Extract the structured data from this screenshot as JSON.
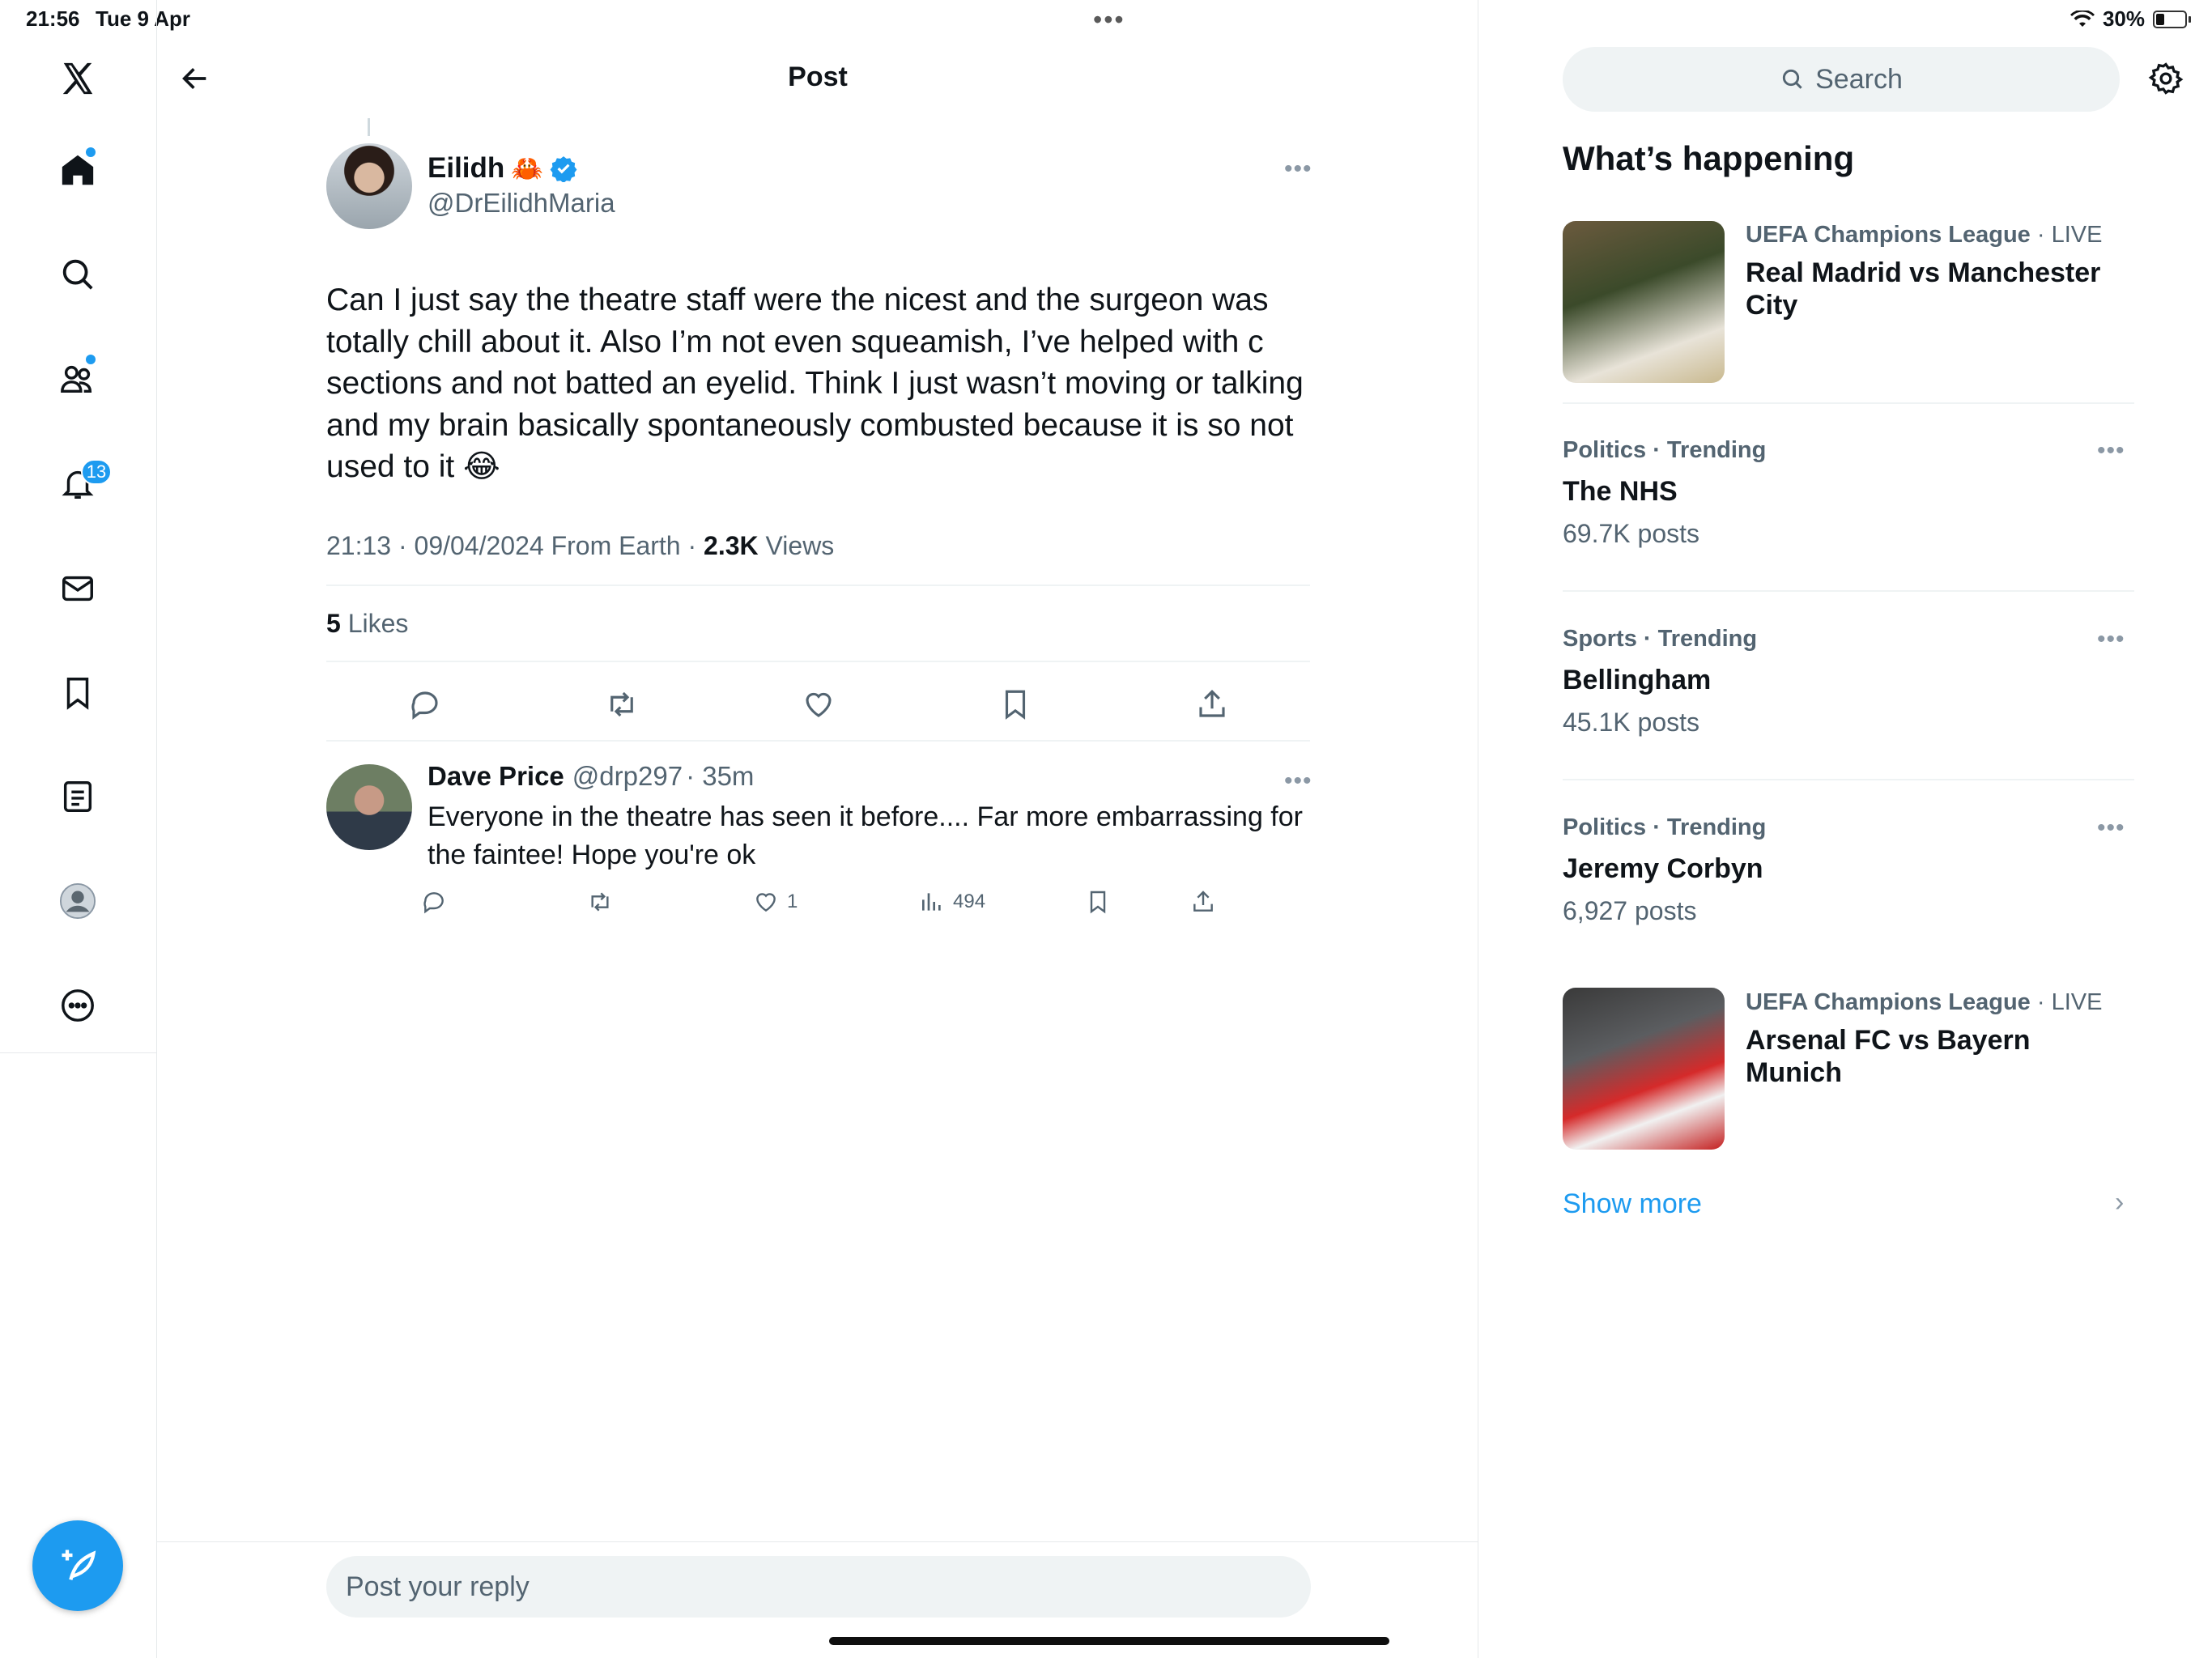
{
  "status_bar": {
    "time": "21:56",
    "date": "Tue 9 Apr",
    "battery": "30%"
  },
  "header": {
    "title": "Post"
  },
  "left_nav": {
    "notifications_count": "13"
  },
  "tweet": {
    "author_name": "Eilidh",
    "author_emoji": "🦀",
    "author_handle": "@DrEilidhMaria",
    "text": "Can I just say the theatre staff were the nicest and the surgeon was totally chill about it. Also I’m not even squeamish, I’ve helped with c sections and not batted an eyelid. Think I just wasn’t moving or talking and my brain basically spontaneously combusted because it is so not used to it 😂",
    "timestamp": "21:13 · 09/04/2024 From Earth · ",
    "views_count": "2.3K",
    "views_label": " Views",
    "likes_count": "5",
    "likes_label": " Likes"
  },
  "reply": {
    "author_name": "Dave Price",
    "author_handle": "@drp297",
    "time": "· 35m",
    "text": "Everyone in the theatre has seen it before.... Far more embarrassing for the faintee! Hope you're ok",
    "likes": "1",
    "views": "494"
  },
  "reply_box": {
    "placeholder": "Post your reply"
  },
  "sidebar": {
    "search_placeholder": "Search",
    "section_title": "What’s happening",
    "trends": [
      {
        "category": "UEFA Champions League",
        "suffix": " · LIVE",
        "title": "Real Madrid vs Manchester City"
      },
      {
        "category": "Politics · Trending",
        "title": "The NHS",
        "count": "69.7K posts"
      },
      {
        "category": "Sports · Trending",
        "title": "Bellingham",
        "count": "45.1K posts"
      },
      {
        "category": "Politics · Trending",
        "title": "Jeremy Corbyn",
        "count": "6,927 posts"
      },
      {
        "category": "UEFA Champions League",
        "suffix": " · LIVE",
        "title": "Arsenal FC vs Bayern Munich"
      }
    ],
    "show_more": "Show more"
  },
  "colors": {
    "accent": "#1d9bf0",
    "text": "#0f1419",
    "muted": "#536471",
    "divider": "#eff3f4"
  }
}
